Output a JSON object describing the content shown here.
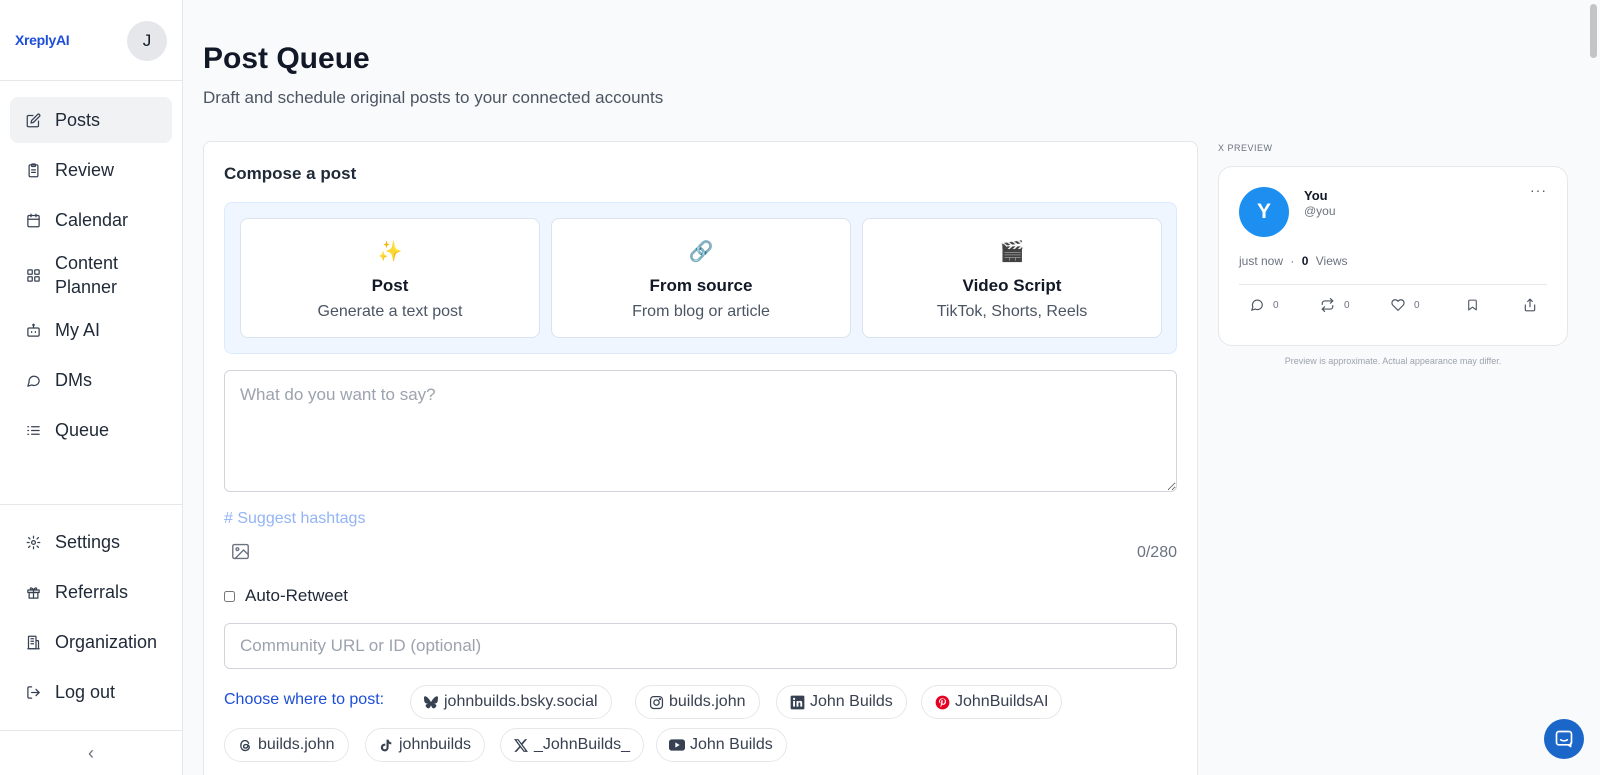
{
  "app": {
    "brand": "XreplyAI",
    "user_initial": "J"
  },
  "sidebar": {
    "items": [
      {
        "label": "Posts",
        "icon": "edit-icon",
        "active": true
      },
      {
        "label": "Review",
        "icon": "clipboard-icon"
      },
      {
        "label": "Calendar",
        "icon": "calendar-icon"
      },
      {
        "label": "Content Planner",
        "icon": "grid-icon"
      },
      {
        "label": "My AI",
        "icon": "bot-icon"
      },
      {
        "label": "DMs",
        "icon": "message-icon"
      },
      {
        "label": "Queue",
        "icon": "list-icon"
      }
    ],
    "bottom": [
      {
        "label": "Settings",
        "icon": "gear-icon"
      },
      {
        "label": "Referrals",
        "icon": "gift-icon"
      },
      {
        "label": "Organization",
        "icon": "building-icon"
      },
      {
        "label": "Log out",
        "icon": "logout-icon"
      }
    ],
    "collapse_glyph": "‹"
  },
  "main": {
    "title": "Post Queue",
    "subtitle": "Draft and schedule original posts to your connected accounts",
    "compose": {
      "title": "Compose a post",
      "modes": [
        {
          "icon": "✨",
          "title": "Post",
          "subtitle": "Generate a text post"
        },
        {
          "icon": "🔗",
          "title": "From source",
          "subtitle": "From blog or article"
        },
        {
          "icon": "🎬",
          "title": "Video Script",
          "subtitle": "TikTok, Shorts, Reels"
        }
      ],
      "text_value": "",
      "text_placeholder": "What do you want to say?",
      "suggest_hashtags": "# Suggest hashtags",
      "char_count": "0/280",
      "auto_retweet_label": "Auto-Retweet",
      "auto_retweet_checked": false,
      "community_value": "",
      "community_placeholder": "Community URL or ID (optional)",
      "choose_label": "Choose where to post:",
      "accounts": [
        {
          "label": "johnbuilds.bsky.social",
          "icon": "bluesky-icon"
        },
        {
          "label": "builds.john",
          "icon": "instagram-icon"
        },
        {
          "label": "John Builds",
          "icon": "linkedin-icon"
        },
        {
          "label": "JohnBuildsAI",
          "icon": "pinterest-icon"
        },
        {
          "label": "builds.john",
          "icon": "threads-icon"
        },
        {
          "label": "johnbuilds",
          "icon": "tiktok-icon"
        },
        {
          "label": "_JohnBuilds_",
          "icon": "x-icon"
        },
        {
          "label": "John Builds",
          "icon": "youtube-icon"
        }
      ]
    }
  },
  "preview": {
    "label": "X PREVIEW",
    "avatar_initial": "Y",
    "name": "You",
    "handle": "@you",
    "more": "···",
    "time": "just now",
    "dot": "·",
    "views_count": "0",
    "views_label": "Views",
    "actions": [
      {
        "icon": "reply-icon",
        "count": "0"
      },
      {
        "icon": "repost-icon",
        "count": "0"
      },
      {
        "icon": "like-icon",
        "count": "0"
      },
      {
        "icon": "bookmark-icon",
        "count": ""
      },
      {
        "icon": "share-icon",
        "count": ""
      }
    ],
    "note": "Preview is approximate. Actual appearance may differ."
  },
  "colors": {
    "accent": "#1d4ed8",
    "x_avatar": "#1d8ff1",
    "mode_panel": "#eff6ff",
    "chat": "#1b66c9"
  }
}
